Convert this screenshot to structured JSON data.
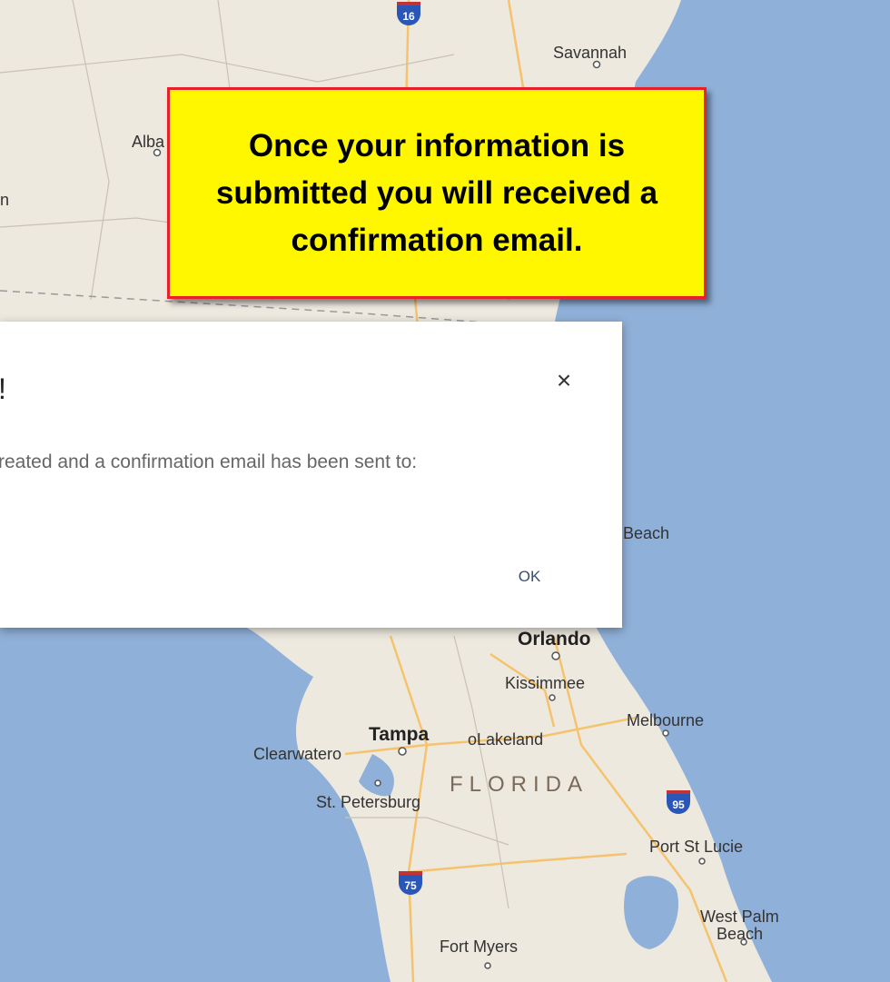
{
  "map": {
    "ocean_color": "#8fb0d9",
    "land_color": "#ede9df",
    "labels": {
      "savannah": "Savannah",
      "albany": "Alba",
      "edge_n": "n",
      "beach": "Beach",
      "orlando": "Orlando",
      "kissimmee": "Kissimmee",
      "melbourne": "Melbourne",
      "tampa": "Tampa",
      "lakeland": "oLakeland",
      "clearwater": "Clearwatero",
      "florida": "FLORIDA",
      "st_petersburg": "St. Petersburg",
      "port_st_lucie": "Port St Lucie",
      "west_palm_1": "West Palm",
      "west_palm_2": "Beach",
      "fort_myers": "Fort Myers"
    },
    "shields": {
      "i16": "16",
      "i95": "95",
      "i75": "75"
    }
  },
  "callout": {
    "text": "Once your information is submitted you will received a confirmation email.",
    "fill": "#fff700",
    "border": "#e8202a"
  },
  "dialog": {
    "title": "!",
    "message": "reated and a confirmation email has been sent to:",
    "close_glyph": "×",
    "ok_label": "OK"
  }
}
